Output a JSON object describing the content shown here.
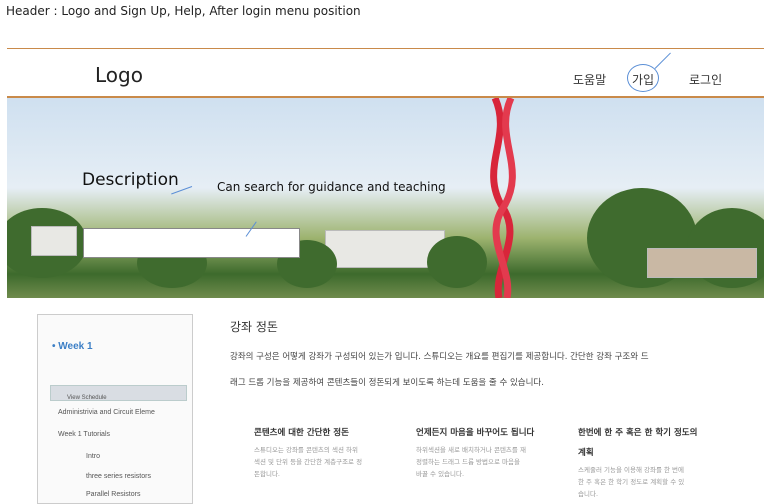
{
  "annotation": {
    "header_note": "Header : Logo and Sign Up, Help, After login menu position",
    "description_label": "Description",
    "search_hint": "Can search for guidance and teaching"
  },
  "header": {
    "logo": "Logo",
    "nav": [
      {
        "label": "도움말"
      },
      {
        "label": "가입"
      },
      {
        "label": "로그인"
      }
    ]
  },
  "course_preview": {
    "week": "• Week 1",
    "bar": "View Schedule",
    "rows": [
      "Administrivia and Circuit Eleme",
      "Week 1 Tutorials",
      "Intro",
      "three series resistors",
      "Parallel Resistors"
    ]
  },
  "main": {
    "title": "강좌 정돈",
    "text_lines": [
      "강좌의 구성은 어떻게 강좌가 구성되어 있는가 입니다. 스튜디오는 개요를 편집기를 제공합니다. 간단한 강좌 구조와 드",
      "래그 드롭 기능을 제공하여 콘텐츠들이 정돈되게 보이도록 하는데 도움을 줄 수 있습니다."
    ],
    "columns": [
      {
        "title": "콘텐츠에 대한 간단한 정돈",
        "text": "스튜디오는 강좌를 콘텐츠의 섹션 하위 섹션 및 단위 등을 간단한 계층구조로 정돈합니다."
      },
      {
        "title": "언제든지 마음을 바꾸어도 됩니다",
        "text": "하위섹션을 새로 배치하거나 콘텐츠를 재정렬하는 드래그 드롭 방법으로 마음을 바꿀 수 있습니다."
      },
      {
        "title": "한번에 한 주 혹은 한 학기 정도의",
        "title2": "계획",
        "text": "스케줄러 기능을 이용해 강좌를 한 번에 한 주 혹은 한 학기 정도로 계획할 수 있습니다."
      }
    ]
  }
}
